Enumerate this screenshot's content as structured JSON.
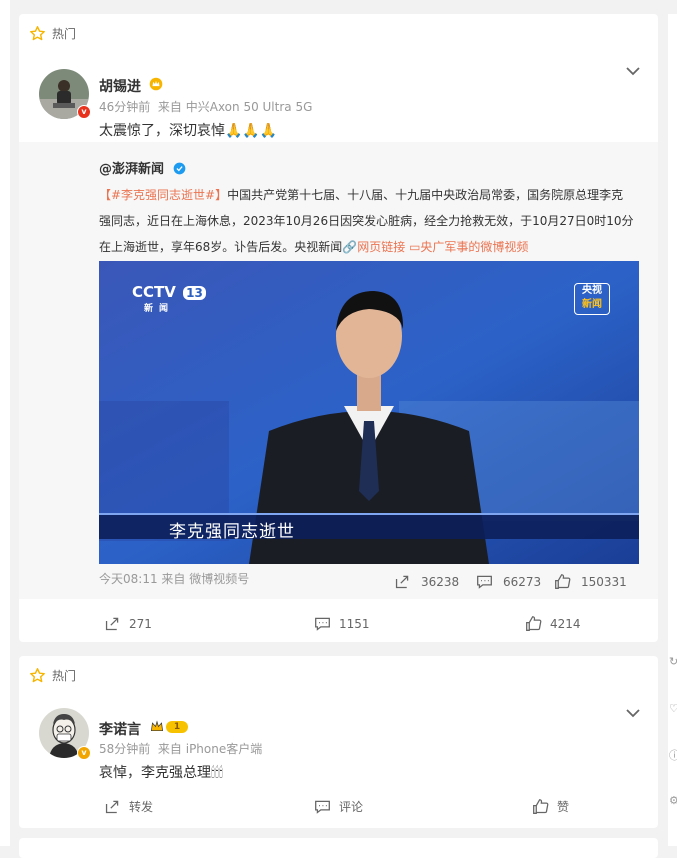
{
  "feed": {
    "card1": {
      "hot_label": "热门",
      "user": "胡锡进",
      "time": "46分钟前",
      "source": "来自 中兴Axon 50 Ultra 5G",
      "text": "太震惊了，深切哀悼🙏🙏🙏",
      "repost": {
        "source_name": "@澎湃新闻",
        "hashtag": "【#李克强同志逝世#】",
        "text_line1": "中国共产党第十七届、十八届、十九届中央政治局常委，国务院原总理李克",
        "text_line2": "强同志，近日在上海休息，2023年10月26日因突发心脏病，经全力抢救无效，于10月27日0时10分",
        "text_line3_prefix": "在上海逝世，享年68岁。讣告后发。央视新闻",
        "link_web": "网页链接",
        "link_video": "央广军事的微博视频",
        "video_caption": "李克强同志逝世",
        "cctv_logo": "CCTV",
        "cctv_channel": "13",
        "cctv_sub": "新闻",
        "corner_logo_top": "央视",
        "corner_logo_bottom": "新闻",
        "time_source": "今天08:11 来自 微博视频号",
        "shares": "36238",
        "comments": "66273",
        "likes": "150331"
      },
      "footer": {
        "shares": "271",
        "comments": "1151",
        "likes": "4214"
      }
    },
    "card2": {
      "hot_label": "热门",
      "user": "李诺言",
      "level": "1",
      "time": "58分钟前",
      "source": "来自 iPhone客户端",
      "text": "哀悼，李克强总理🕯🕯🕯",
      "footer": {
        "share": "转发",
        "comment": "评论",
        "like": "赞"
      }
    }
  },
  "colors": {
    "link": "#eb7350",
    "verified_orange": "#f2a500",
    "verified_red": "#e8321e",
    "accent": "#f7b500"
  }
}
